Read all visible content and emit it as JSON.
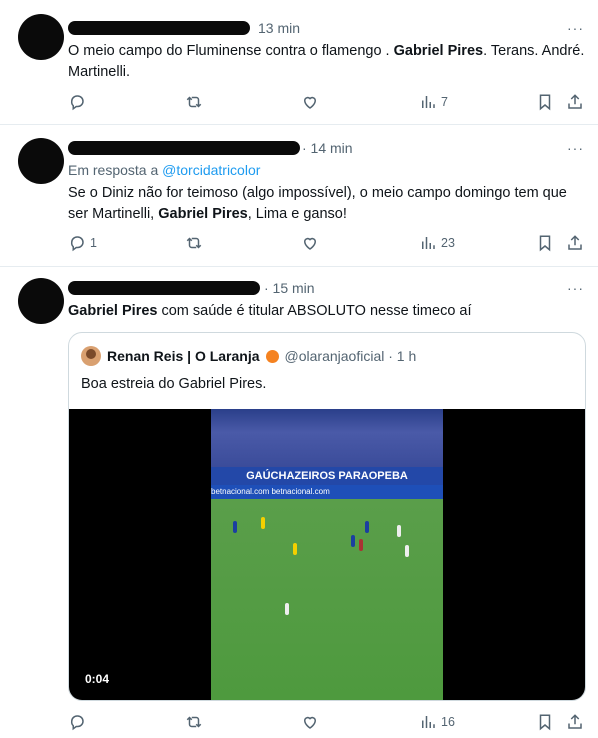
{
  "tweets": [
    {
      "time": "13 min",
      "more": "···",
      "text_parts": [
        "O meio campo do Fluminense contra o flamengo . ",
        "Gabriel Pires",
        ". Terans. André. Martinelli."
      ],
      "replies": "",
      "views": "7"
    },
    {
      "time": "· 14 min",
      "more": "···",
      "reply_prefix": "Em resposta a ",
      "reply_mention": "@torcidatricolor",
      "text_parts": [
        "Se o Diniz não for teimoso (algo impossível), o meio campo domingo tem que ser Martinelli, ",
        "Gabriel Pires",
        ", Lima e ganso!"
      ],
      "replies": "1",
      "views": "23"
    },
    {
      "time": "· 15 min",
      "more": "···",
      "text_parts": [
        "Gabriel Pires",
        " com saúde é titular ABSOLUTO nesse timeco aí"
      ],
      "replies": "",
      "views": "16",
      "quote": {
        "name": "Renan Reis | O Laranja",
        "handle": "@olaranjaoficial · 1 h",
        "text": "Boa estreia do Gabriel Pires.",
        "video_time": "0:04",
        "board_text": "GAÚCHAZEIROS   PARAOPEBA",
        "board_sub": "betnacional.com   betnacional.com"
      }
    }
  ],
  "colors": {
    "accent": "#1d9bf0",
    "muted": "#536471",
    "text": "#0f1419",
    "border": "#e6ecf0"
  }
}
